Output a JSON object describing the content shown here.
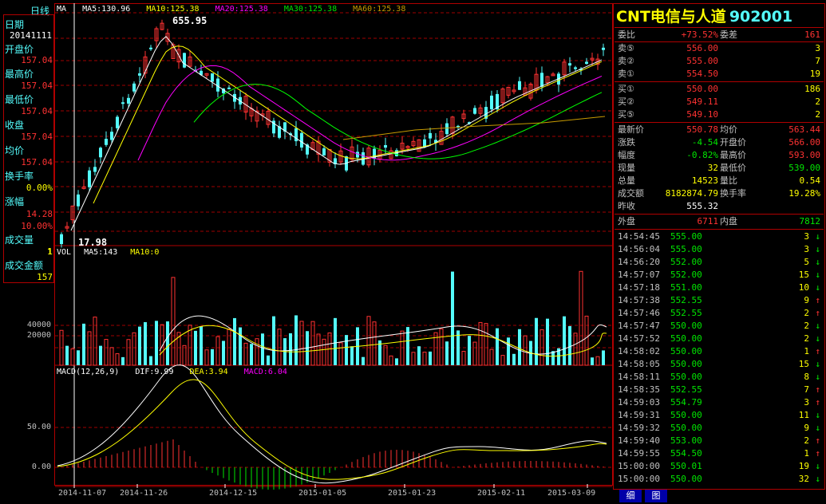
{
  "chart_title": "日线",
  "main_legend": {
    "ma": "MA",
    "ma5": "MA5:130.96",
    "ma10": "MA10:125.38",
    "ma20": "MA20:125.38",
    "ma30": "MA30:125.38",
    "ma60": "MA60:125.38"
  },
  "colors": {
    "up": "#ff3232",
    "down": "#54fcfc",
    "ma5": "#ffffff",
    "ma10": "#ffff00",
    "ma20": "#ff00ff",
    "ma30": "#00ff00",
    "ma60": "#c89b00",
    "grid": "#a00000"
  },
  "left_info": {
    "date_label": "日期",
    "date_value": "20141111",
    "open_label": "开盘价",
    "open_value": "157.04",
    "high_label": "最高价",
    "high_value": "157.04",
    "low_label": "最低价",
    "low_value": "157.04",
    "close_label": "收盘",
    "close_value": "157.04",
    "avg_label": "均价",
    "avg_value": "157.04",
    "turnover_label": "换手率",
    "turnover_value": "0.00%",
    "amplitude_label": "涨幅",
    "amplitude_value": "14.28",
    "amplitude_pct": "10.00%",
    "volume_label": "成交量",
    "volume_value": "1",
    "amount_label": "成交金额",
    "amount_value": "157"
  },
  "annotations": {
    "peak": "655.95",
    "low": "17.98"
  },
  "vol_legend": {
    "vol": "VOL",
    "ma5": "MA5:143",
    "ma10": "MA10:0"
  },
  "vol_ticks": [
    "40000",
    "20000"
  ],
  "macd_legend": {
    "name": "MACD(12,26,9)",
    "dif": "DIF:9.99",
    "dea": "DEA:3.94",
    "macd": "MACD:6.04"
  },
  "macd_ticks": [
    "50.00",
    "0.00"
  ],
  "x_labels": [
    "2014-11-07",
    "2014-11-26",
    "2014-12-15",
    "2015-01-05",
    "2015-01-23",
    "2015-02-11",
    "2015-03-09"
  ],
  "right_panel": {
    "title": "CNT电信与人道",
    "code": "902001",
    "weibi_label": "委比",
    "weibi_value": "+73.52%",
    "weicha_label": "委差",
    "weicha_value": "161",
    "asks": [
      {
        "label": "卖⑤",
        "price": "556.00",
        "vol": "3"
      },
      {
        "label": "卖②",
        "price": "555.00",
        "vol": "7"
      },
      {
        "label": "卖①",
        "price": "554.50",
        "vol": "19"
      }
    ],
    "bids": [
      {
        "label": "买①",
        "price": "550.00",
        "vol": "186"
      },
      {
        "label": "买②",
        "price": "549.11",
        "vol": "2"
      },
      {
        "label": "买⑤",
        "price": "549.10",
        "vol": "2"
      }
    ],
    "stats": [
      {
        "l1": "最新价",
        "v1": "550.78",
        "c1": "red",
        "l2": "均价",
        "v2": "563.44",
        "c2": "red"
      },
      {
        "l1": "涨跌",
        "v1": "-4.54",
        "c1": "green",
        "l2": "开盘价",
        "v2": "566.00",
        "c2": "red"
      },
      {
        "l1": "幅度",
        "v1": "-0.82%",
        "c1": "green",
        "l2": "最高价",
        "v2": "593.00",
        "c2": "red"
      },
      {
        "l1": "现量",
        "v1": "32",
        "c1": "yellow",
        "l2": "最低价",
        "v2": "539.00",
        "c2": "green"
      },
      {
        "l1": "总量",
        "v1": "14523",
        "c1": "yellow",
        "l2": "量比",
        "v2": "0.54",
        "c2": "yellow"
      },
      {
        "l1": "成交额",
        "v1": "8182874.79",
        "c1": "yellow",
        "l2": "换手率",
        "v2": "19.28%",
        "c2": "yellow"
      },
      {
        "l1": "昨收",
        "v1": "555.32",
        "c1": "white",
        "l2": "",
        "v2": "",
        "c2": "white"
      }
    ],
    "outer_label": "外盘",
    "outer_value": "6711",
    "inner_label": "内盘",
    "inner_value": "7812",
    "ticks": [
      {
        "time": "14:54:45",
        "price": "555.00",
        "vol": "3",
        "dir": "down"
      },
      {
        "time": "14:56:04",
        "price": "555.00",
        "vol": "3",
        "dir": "down"
      },
      {
        "time": "14:56:20",
        "price": "552.00",
        "vol": "5",
        "dir": "down"
      },
      {
        "time": "14:57:07",
        "price": "552.00",
        "vol": "15",
        "dir": "down"
      },
      {
        "time": "14:57:18",
        "price": "551.00",
        "vol": "10",
        "dir": "down"
      },
      {
        "time": "14:57:38",
        "price": "552.55",
        "vol": "9",
        "dir": "up"
      },
      {
        "time": "14:57:46",
        "price": "552.55",
        "vol": "2",
        "dir": "up"
      },
      {
        "time": "14:57:47",
        "price": "550.00",
        "vol": "2",
        "dir": "down"
      },
      {
        "time": "14:57:52",
        "price": "550.00",
        "vol": "2",
        "dir": "down"
      },
      {
        "time": "14:58:02",
        "price": "550.00",
        "vol": "1",
        "dir": "up"
      },
      {
        "time": "14:58:05",
        "price": "550.00",
        "vol": "15",
        "dir": "down"
      },
      {
        "time": "14:58:11",
        "price": "550.00",
        "vol": "8",
        "dir": "down"
      },
      {
        "time": "14:58:35",
        "price": "552.55",
        "vol": "7",
        "dir": "up"
      },
      {
        "time": "14:59:03",
        "price": "554.79",
        "vol": "3",
        "dir": "up"
      },
      {
        "time": "14:59:31",
        "price": "550.00",
        "vol": "11",
        "dir": "down"
      },
      {
        "time": "14:59:32",
        "price": "550.00",
        "vol": "9",
        "dir": "down"
      },
      {
        "time": "14:59:40",
        "price": "553.00",
        "vol": "2",
        "dir": "up"
      },
      {
        "time": "14:59:55",
        "price": "554.50",
        "vol": "1",
        "dir": "up"
      },
      {
        "time": "15:00:00",
        "price": "550.01",
        "vol": "19",
        "dir": "down"
      },
      {
        "time": "15:00:00",
        "price": "550.00",
        "vol": "32",
        "dir": "down"
      }
    ],
    "tabs": [
      "细",
      "图"
    ]
  }
}
